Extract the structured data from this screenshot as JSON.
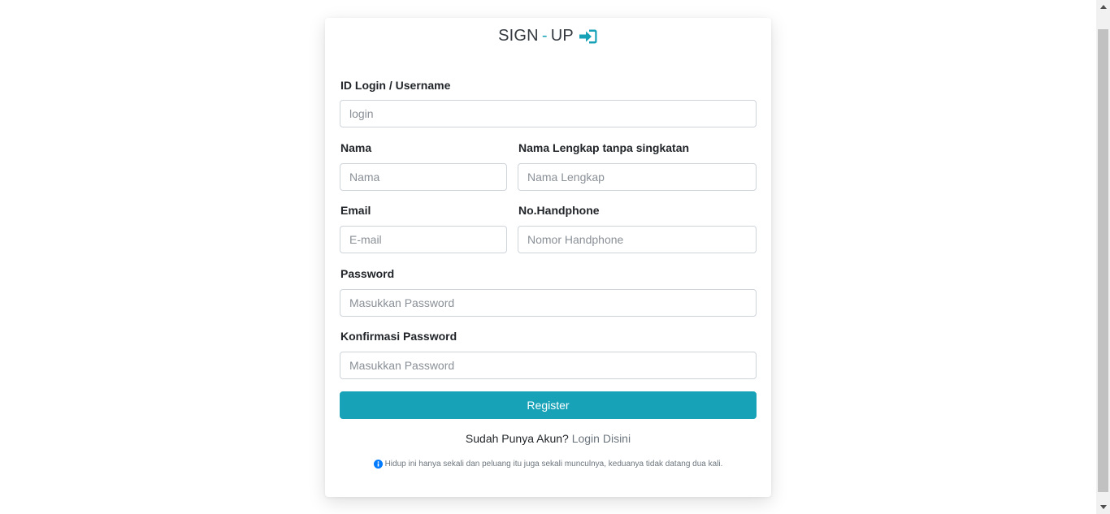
{
  "header": {
    "title_part1": "SIGN",
    "title_dash": "-",
    "title_part2": "UP"
  },
  "form": {
    "login": {
      "label": "ID Login / Username",
      "placeholder": "login"
    },
    "nama": {
      "label": "Nama",
      "placeholder": "Nama"
    },
    "nama_lengkap": {
      "label": "Nama Lengkap tanpa singkatan",
      "placeholder": "Nama Lengkap"
    },
    "email": {
      "label": "Email",
      "placeholder": "E-mail"
    },
    "handphone": {
      "label": "No.Handphone",
      "placeholder": "Nomor Handphone"
    },
    "password": {
      "label": "Password",
      "placeholder": "Masukkan Password"
    },
    "konfirmasi_password": {
      "label": "Konfirmasi Password",
      "placeholder": "Masukkan Password"
    },
    "register_label": "Register"
  },
  "footer": {
    "have_account_text": "Sudah Punya Akun?",
    "login_link": "Login Disini",
    "quote": "Hidup ini hanya sekali dan peluang itu juga sekali munculnya, keduanya tidak datang dua kali."
  },
  "colors": {
    "accent": "#17a2b8",
    "info_icon": "#007bff"
  },
  "icons": {
    "title_icon": "sign-in-icon",
    "quote_icon": "info-circle-icon"
  }
}
